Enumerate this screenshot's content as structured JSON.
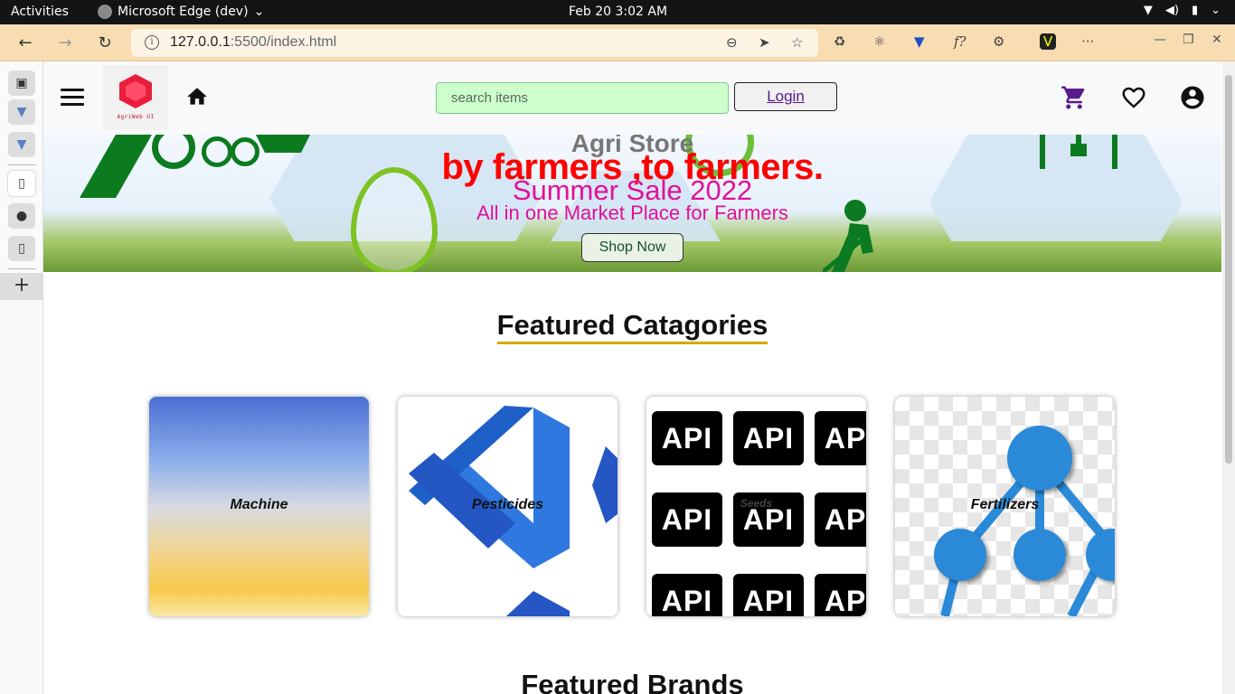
{
  "os": {
    "activities": "Activities",
    "app_name": "Microsoft Edge (dev)",
    "clock": "Feb 20  3:02 AM"
  },
  "browser": {
    "url_host": "127.0.0.1",
    "url_rest": ":5500/index.html"
  },
  "header": {
    "logo_text": "AgriWeb UI",
    "search_placeholder": "search items",
    "login_label": "Login"
  },
  "banner": {
    "title1": "Agri Store",
    "title2": "by farmers ,to farmers.",
    "title3": "Summer Sale 2022",
    "title4": "All in one Market Place for Farmers",
    "shop_label": "Shop Now"
  },
  "featured_categories": {
    "title": "Featured Catagories",
    "items": [
      {
        "label": "Machine"
      },
      {
        "label": "Pesticides"
      },
      {
        "label": "Seeds"
      },
      {
        "label": "Fertilizers"
      }
    ]
  },
  "featured_brands": {
    "title": "Featured Brands"
  },
  "colors": {
    "browser_toolbar": "#f9ddb2",
    "search_bg": "#ccffcc",
    "banner_red": "#ff0000",
    "banner_pink": "#e0119b",
    "cart_purple": "#5b1a8b",
    "underline_gold": "#d4a900"
  },
  "icons": [
    "menu-icon",
    "home-icon",
    "cart-icon",
    "heart-icon",
    "account-icon"
  ]
}
